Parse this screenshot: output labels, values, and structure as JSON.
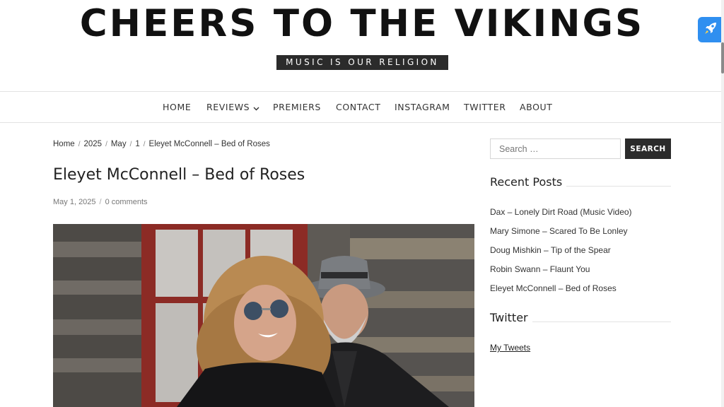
{
  "header": {
    "site_title": "CHEERS TO THE VIKINGS",
    "tagline": "MUSIC IS OUR RELIGION"
  },
  "nav": {
    "items": [
      {
        "label": "HOME"
      },
      {
        "label": "REVIEWS"
      },
      {
        "label": "PREMIERS"
      },
      {
        "label": "CONTACT"
      },
      {
        "label": "INSTAGRAM"
      },
      {
        "label": "TWITTER"
      },
      {
        "label": "ABOUT"
      }
    ]
  },
  "breadcrumb": {
    "items": [
      "Home",
      "2025",
      "May",
      "1",
      "Eleyet McConnell – Bed of Roses"
    ]
  },
  "post": {
    "title": "Eleyet McConnell – Bed of Roses",
    "date": "May 1, 2025",
    "comments": "0 comments"
  },
  "sidebar": {
    "search_placeholder": "Search …",
    "search_button": "SEARCH",
    "recent_posts_title": "Recent Posts",
    "recent_posts": [
      "Dax – Lonely Dirt Road (Music Video)",
      "Mary Simone – Scared To Be Lonley",
      "Doug Mishkin – Tip of the Spear",
      "Robin Swann – Flaunt You",
      "Eleyet McConnell – Bed of Roses"
    ],
    "twitter_title": "Twitter",
    "twitter_link": "My Tweets"
  },
  "colors": {
    "accent_dark": "#2b2b2b",
    "rocket_button": "#2f8ff0"
  },
  "icons": {
    "rocket": "rocket-icon",
    "chevron": "chevron-down-icon"
  }
}
